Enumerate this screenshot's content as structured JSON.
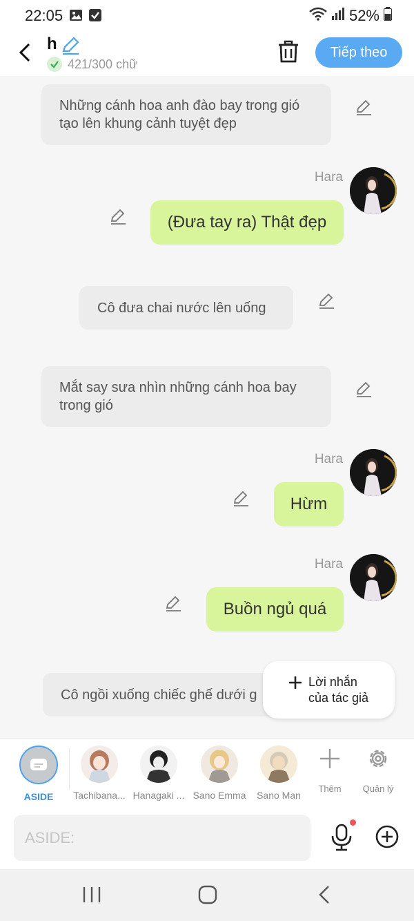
{
  "status_bar": {
    "time": "22:05",
    "battery": "52%",
    "icons": [
      "image-icon",
      "checkbox-icon",
      "wifi-icon",
      "signal-icon",
      "battery-icon"
    ]
  },
  "header": {
    "title": "h",
    "char_count": "421/300 chữ",
    "next_label": "Tiếp theo",
    "accent": "#5aa9f3"
  },
  "messages": [
    {
      "type": "narration",
      "text": "Những cánh hoa anh đào bay trong gió tạo lên khung cảnh tuyệt đẹp"
    },
    {
      "type": "dialogue",
      "sender": "Hara",
      "text": "(Đưa tay ra) Thật đẹp"
    },
    {
      "type": "narration",
      "text": "Cô đưa chai nước lên uống"
    },
    {
      "type": "narration",
      "text": "Mắt say sưa nhìn những cánh hoa bay trong gió"
    },
    {
      "type": "dialogue",
      "sender": "Hara",
      "text": "Hừm"
    },
    {
      "type": "dialogue",
      "sender": "Hara",
      "text": "Buồn ngủ quá"
    },
    {
      "type": "narration",
      "text": "Cô ngồi xuống chiếc ghế dưới g"
    }
  ],
  "floating_button": {
    "line1": "Lời nhắn",
    "line2": "của tác giả"
  },
  "characters": [
    {
      "label": "ASIDE"
    },
    {
      "label": "Tachibana..."
    },
    {
      "label": "Hanagaki ..."
    },
    {
      "label": "Sano Emma"
    },
    {
      "label": "Sano Man"
    }
  ],
  "tools": {
    "add_label": "Thêm",
    "manage_label": "Quản lý"
  },
  "input": {
    "placeholder": "ASIDE:"
  },
  "colors": {
    "dialogue_bubble": "#d9f59b",
    "narration_bubble": "#ececec",
    "mic_dot": "#f0525b"
  }
}
